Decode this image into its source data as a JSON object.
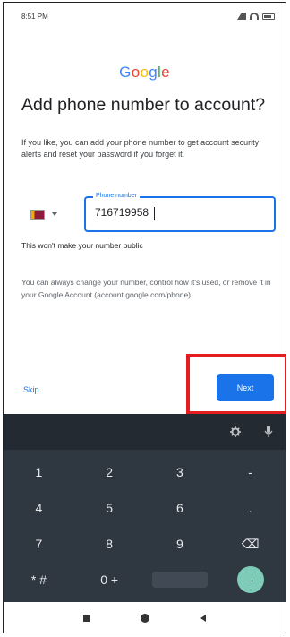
{
  "status_bar": {
    "time": "8:51 PM"
  },
  "logo": {
    "letters": [
      "G",
      "o",
      "o",
      "g",
      "l",
      "e"
    ]
  },
  "page": {
    "title": "Add phone number to account?",
    "description": "If you like, you can add your phone number to get account security alerts and reset your password if you forget it.",
    "public_note": "This won't make your number public",
    "info_text": "You can always change your number, control how it's used, or remove it in your Google Account (account.google.com/phone)"
  },
  "phone_field": {
    "label": "Phone number",
    "value": "716719958"
  },
  "actions": {
    "skip_label": "Skip",
    "next_label": "Next"
  },
  "keyboard": {
    "rows": [
      [
        "1",
        "2",
        "3",
        "-"
      ],
      [
        "4",
        "5",
        "6",
        "."
      ],
      [
        "7",
        "8",
        "9",
        "⌫"
      ],
      [
        "* #",
        "0 +",
        "",
        "→"
      ]
    ]
  },
  "colors": {
    "accent": "#1a73e8",
    "highlight": "#e41e1e",
    "keyboard_bg": "#2f3740",
    "enter_key": "#7ecbb7"
  }
}
